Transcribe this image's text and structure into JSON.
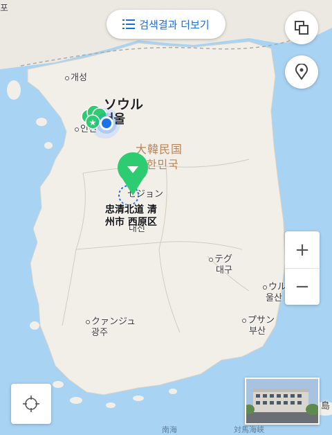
{
  "search_more": {
    "label": "검색결과 더보기",
    "icon": "list-icon"
  },
  "controls": {
    "layers_icon": "layers-icon",
    "poi_icon": "map-pin-outline-icon",
    "zoom_in": "+",
    "zoom_out": "−",
    "locate_icon": "crosshair-icon",
    "thumbnail_icon": "street-view-thumbnail"
  },
  "labels": {
    "top_left": "포",
    "kaesong": "개성",
    "seoul_jp": "ソウル",
    "seoul_kr": "서울",
    "incheon": "인천",
    "country_cn": "大韓民国",
    "country_kr": "대한민국",
    "sejong_jp": "セジョン",
    "daejeon_partial": "대전",
    "daegu_jp": "テグ",
    "daegu_kr": "대구",
    "ulsan_jp": "ウル",
    "ulsan_kr": "울산",
    "gwangju_jp": "クァンジュ",
    "gwangju_kr": "광주",
    "busan_jp": "プサン",
    "busan_kr": "부산",
    "sea_south": "南海",
    "sea_strait": "対馬海峡",
    "island_right": "島"
  },
  "selected_place": {
    "line1": "忠清北道 清",
    "line2": "州市 西原区"
  },
  "colors": {
    "water": "#a9d3f2",
    "land": "#f2efe9",
    "accent": "#1a6fd6",
    "pin_green": "#2ecc71",
    "location_blue": "#1a73e8"
  }
}
